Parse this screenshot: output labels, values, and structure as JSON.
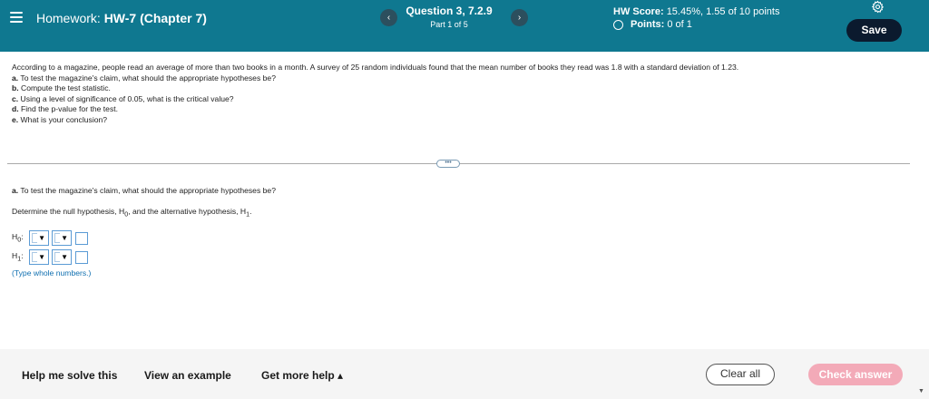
{
  "header": {
    "hw_prefix": "Homework: ",
    "hw_name": "HW-7 (Chapter 7)",
    "question_title": "Question 3, 7.2.9",
    "question_part": "Part 1 of 5",
    "prev_label": "‹",
    "next_label": "›",
    "hw_score_label": "HW Score: ",
    "hw_score_value": "15.45%, 1.55 of 10 points",
    "points_label": "Points: ",
    "points_value": "0 of 1",
    "save_label": "Save",
    "accent_color": "#0f7890"
  },
  "problem": {
    "stem": "According to a magazine, people read an average of more than two books in a month. A survey of 25 random individuals found that the mean number of books they read was 1.8 with a standard deviation of 1.23.",
    "items": [
      {
        "letter": "a.",
        "text": " To test the magazine's claim, what should the appropriate hypotheses be?"
      },
      {
        "letter": "b.",
        "text": " Compute the test statistic."
      },
      {
        "letter": "c.",
        "text": " Using a level of significance of 0.05, what is the critical value?"
      },
      {
        "letter": "d.",
        "text": " Find the p-value for the test."
      },
      {
        "letter": "e.",
        "text": " What is your conclusion?"
      }
    ]
  },
  "more_handle": "•••",
  "part_a": {
    "letter": "a.",
    "question": " To test the magazine's claim, what should the appropriate hypotheses be?",
    "instruction_pre": "Determine the null hypothesis, H",
    "instruction_mid": ", and the alternative hypothesis, H",
    "sub0": "0",
    "sub1": "1",
    "h0_label": "H",
    "h1_label": "H",
    "hint": "(Type whole numbers.)"
  },
  "footer": {
    "help": "Help me solve this",
    "example": "View an example",
    "more_help": "Get more help ▴",
    "clear": "Clear all",
    "check": "Check answer",
    "check_color": "#f3aab8"
  }
}
